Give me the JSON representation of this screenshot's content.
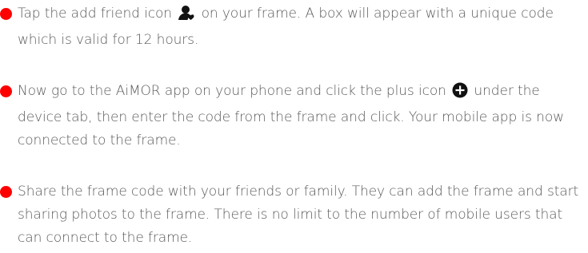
{
  "steps": [
    {
      "before": "Tap the add friend icon ",
      "icon": "add-friend-icon",
      "after": " on your frame. A box will appear with a unique code which is valid for 12 hours."
    },
    {
      "before": "Now go to the AiMOR app on your phone and click the plus icon ",
      "icon": "plus-circle-icon",
      "after": " under the device tab, then enter the code from the frame and click. Your mobile app is now connected to the frame."
    },
    {
      "text": "Share the frame code with your friends or family. They can add the frame and start sharing photos to the frame. There is no limit to the number of mobile users that can connect to the frame."
    }
  ],
  "colors": {
    "bullet": "#ff0000",
    "text": "#5a5a5a",
    "icon": "#111111"
  }
}
